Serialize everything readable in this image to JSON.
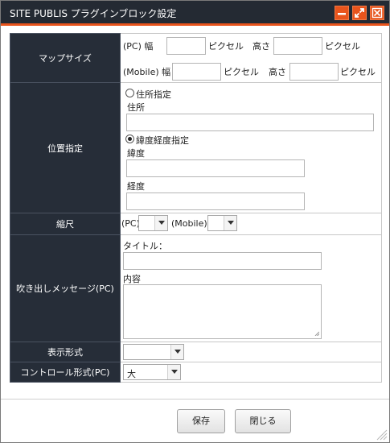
{
  "dialog": {
    "title": "SITE PUBLIS プラグインブロック設定",
    "buttons": {
      "minimize": "minimize-icon",
      "maximize": "maximize-icon",
      "close": "close-icon"
    }
  },
  "colors": {
    "titlebar": "#242a33",
    "accent": "#e8541c",
    "label_bg": "#262d38"
  },
  "map_size": {
    "label": "マップサイズ",
    "pc_prefix": "(PC) 幅",
    "mobile_prefix": "(Mobile) 幅",
    "pixel_unit": "ピクセル",
    "height_label": "高さ",
    "pc_width": "",
    "pc_height": "",
    "mobile_width": "",
    "mobile_height": ""
  },
  "position": {
    "label": "位置指定",
    "address_option": "住所指定",
    "address_label": "住所",
    "address_value": "",
    "latlng_option": "緯度経度指定",
    "latitude_label": "緯度",
    "latitude_value": "",
    "longitude_label": "経度",
    "longitude_value": "",
    "selected": "latlng"
  },
  "scale": {
    "label": "縮尺",
    "pc_label": "(PC)",
    "mobile_label": "(Mobile)",
    "pc_value": "",
    "mobile_value": ""
  },
  "balloon": {
    "label": "吹き出しメッセージ(PC)",
    "title_label": "タイトル：",
    "title_value": "",
    "content_label": "内容",
    "content_value": ""
  },
  "display_format": {
    "label": "表示形式",
    "value": ""
  },
  "control_format": {
    "label": "コントロール形式(PC)",
    "value": "大"
  },
  "footer": {
    "save_label": "保存",
    "close_label": "閉じる"
  }
}
